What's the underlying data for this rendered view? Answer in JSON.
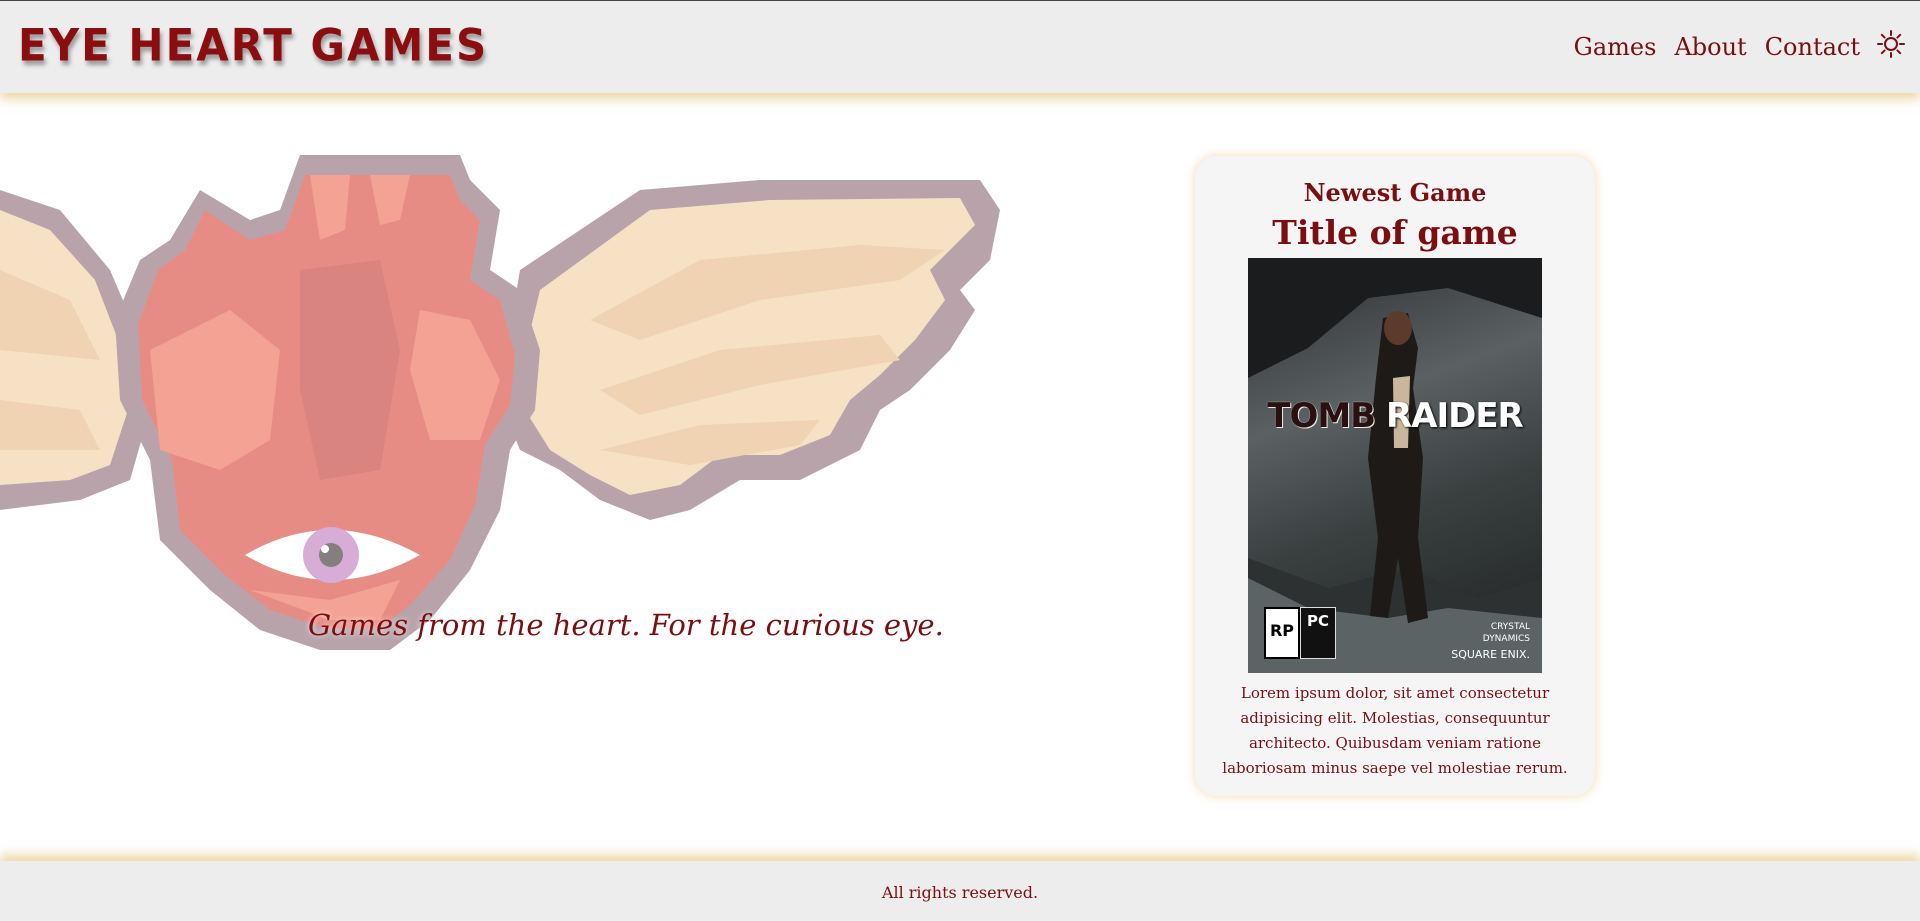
{
  "header": {
    "brand": "EYE HEART GAMES",
    "nav": [
      "Games",
      "About",
      "Contact"
    ],
    "theme_icon": "sun-icon"
  },
  "hero": {
    "tagline": "Games from the heart. For the curious eye.",
    "illustration": "winged-heart-eye-icon"
  },
  "newest": {
    "heading": "Newest Game",
    "title": "Title of game",
    "cover": {
      "title_word1": "TOMB",
      "title_word2": "RAIDER",
      "rating": "RP",
      "platform": "PC",
      "publisher_line1": "CRYSTAL",
      "publisher_line2": "DYNAMICS",
      "publisher_line3": "SQUARE ENIX."
    },
    "description": "Lorem ipsum dolor, sit amet consectetur adipisicing elit. Molestias, consequuntur architecto. Quibusdam veniam ratione laboriosam minus saepe vel molestiae rerum."
  },
  "footer": {
    "text": "All rights reserved."
  },
  "colors": {
    "accent": "#7a0e10",
    "header_bg": "#ededed",
    "glow": "#deb45a"
  }
}
